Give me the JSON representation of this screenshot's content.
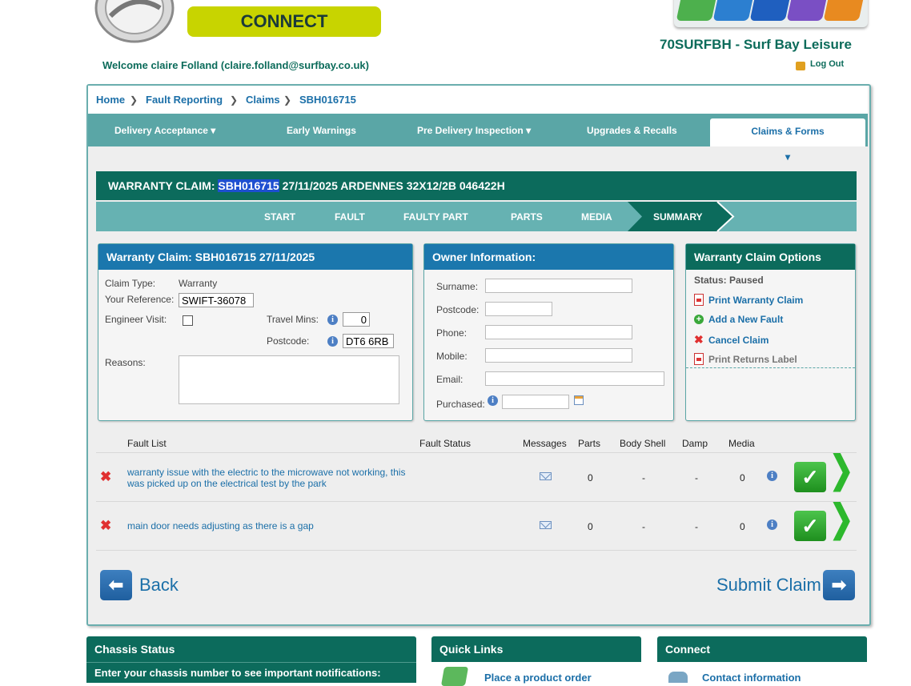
{
  "header": {
    "brand": "CONNECT",
    "welcome": "Welcome claire Folland (claire.folland@surfbay.co.uk)",
    "dealer": "70SURFBH - Surf Bay Leisure",
    "logout": "Log Out",
    "top_icons": [
      "caravan-icon",
      "van-icon",
      "truck-icon",
      "gear-icon",
      "tools-icon"
    ],
    "colors": {
      "brand_green": "#c8d400",
      "dark_teal": "#0c6b5c",
      "teal": "#5aa6a6",
      "link_blue": "#1b6fa8"
    }
  },
  "breadcrumb": [
    "Home",
    "Fault Reporting",
    "Claims",
    "SBH016715"
  ],
  "nav": {
    "items": [
      "Delivery Acceptance",
      "Early Warnings",
      "Pre Delivery Inspection",
      "Upgrades & Recalls",
      "Claims & Forms"
    ],
    "active": "Claims & Forms"
  },
  "claim": {
    "title_prefix": "WARRANTY CLAIM:",
    "number": "SBH016715",
    "title_rest": "27/11/2025 ARDENNES 32X12/2B 046422H"
  },
  "steps": [
    "START",
    "FAULT",
    "FAULTY PART",
    "PARTS",
    "MEDIA",
    "SUMMARY"
  ],
  "active_step": "SUMMARY",
  "claim_panel": {
    "title": "Warranty Claim: SBH016715 27/11/2025",
    "claim_type_label": "Claim Type:",
    "claim_type": "Warranty",
    "reference_label": "Your Reference:",
    "reference": "SWIFT-36078",
    "engineer_label": "Engineer Visit:",
    "engineer_visit": false,
    "travel_label": "Travel Mins:",
    "travel_mins": "0",
    "postcode_label": "Postcode:",
    "postcode": "DT6 6RB",
    "reasons_label": "Reasons:",
    "reasons": ""
  },
  "owner_panel": {
    "title": "Owner Information:",
    "surname_label": "Surname:",
    "postcode_label": "Postcode:",
    "phone_label": "Phone:",
    "mobile_label": "Mobile:",
    "email_label": "Email:",
    "purchased_label": "Purchased:",
    "surname": "",
    "postcode": "",
    "phone": "",
    "mobile": "",
    "email": "",
    "purchased": ""
  },
  "options_panel": {
    "title": "Warranty Claim Options",
    "status": "Status: Paused",
    "options": [
      "Print Warranty Claim",
      "Add a New Fault",
      "Cancel Claim",
      "Print Returns Label"
    ]
  },
  "fault_list": {
    "headers": [
      "Fault List",
      "Fault Status",
      "Messages",
      "Parts",
      "Body Shell",
      "Damp",
      "Media"
    ],
    "rows": [
      {
        "description": "warranty issue with the electric to the microwave not working, this was picked up on the electrical test by the park",
        "status": "",
        "parts": "0",
        "body_shell": "-",
        "damp": "-",
        "media": "0"
      },
      {
        "description": "main door needs adjusting as there is a gap",
        "status": "",
        "parts": "0",
        "body_shell": "-",
        "damp": "-",
        "media": "0"
      }
    ]
  },
  "actions": {
    "back": "Back",
    "submit": "Submit Claim"
  },
  "bottom": {
    "chassis_title": "Chassis Status",
    "chassis_text": "Enter your chassis number to see important notifications:",
    "quicklinks_title": "Quick Links",
    "quicklinks_item": "Place a product order",
    "connect_title": "Connect",
    "connect_item": "Contact information"
  }
}
